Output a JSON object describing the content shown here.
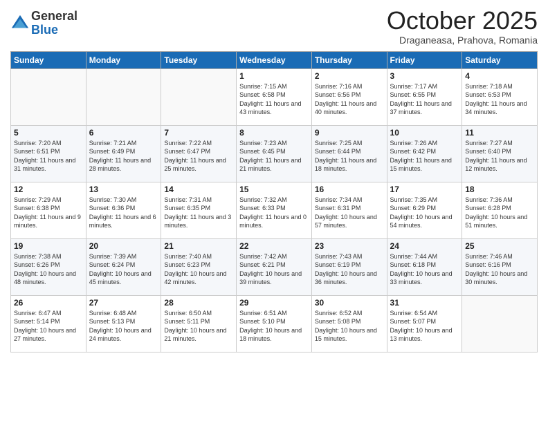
{
  "header": {
    "logo_general": "General",
    "logo_blue": "Blue",
    "month_title": "October 2025",
    "subtitle": "Draganeasa, Prahova, Romania"
  },
  "weekdays": [
    "Sunday",
    "Monday",
    "Tuesday",
    "Wednesday",
    "Thursday",
    "Friday",
    "Saturday"
  ],
  "weeks": [
    [
      {
        "day": "",
        "info": ""
      },
      {
        "day": "",
        "info": ""
      },
      {
        "day": "",
        "info": ""
      },
      {
        "day": "1",
        "info": "Sunrise: 7:15 AM\nSunset: 6:58 PM\nDaylight: 11 hours and 43 minutes."
      },
      {
        "day": "2",
        "info": "Sunrise: 7:16 AM\nSunset: 6:56 PM\nDaylight: 11 hours and 40 minutes."
      },
      {
        "day": "3",
        "info": "Sunrise: 7:17 AM\nSunset: 6:55 PM\nDaylight: 11 hours and 37 minutes."
      },
      {
        "day": "4",
        "info": "Sunrise: 7:18 AM\nSunset: 6:53 PM\nDaylight: 11 hours and 34 minutes."
      }
    ],
    [
      {
        "day": "5",
        "info": "Sunrise: 7:20 AM\nSunset: 6:51 PM\nDaylight: 11 hours and 31 minutes."
      },
      {
        "day": "6",
        "info": "Sunrise: 7:21 AM\nSunset: 6:49 PM\nDaylight: 11 hours and 28 minutes."
      },
      {
        "day": "7",
        "info": "Sunrise: 7:22 AM\nSunset: 6:47 PM\nDaylight: 11 hours and 25 minutes."
      },
      {
        "day": "8",
        "info": "Sunrise: 7:23 AM\nSunset: 6:45 PM\nDaylight: 11 hours and 21 minutes."
      },
      {
        "day": "9",
        "info": "Sunrise: 7:25 AM\nSunset: 6:44 PM\nDaylight: 11 hours and 18 minutes."
      },
      {
        "day": "10",
        "info": "Sunrise: 7:26 AM\nSunset: 6:42 PM\nDaylight: 11 hours and 15 minutes."
      },
      {
        "day": "11",
        "info": "Sunrise: 7:27 AM\nSunset: 6:40 PM\nDaylight: 11 hours and 12 minutes."
      }
    ],
    [
      {
        "day": "12",
        "info": "Sunrise: 7:29 AM\nSunset: 6:38 PM\nDaylight: 11 hours and 9 minutes."
      },
      {
        "day": "13",
        "info": "Sunrise: 7:30 AM\nSunset: 6:36 PM\nDaylight: 11 hours and 6 minutes."
      },
      {
        "day": "14",
        "info": "Sunrise: 7:31 AM\nSunset: 6:35 PM\nDaylight: 11 hours and 3 minutes."
      },
      {
        "day": "15",
        "info": "Sunrise: 7:32 AM\nSunset: 6:33 PM\nDaylight: 11 hours and 0 minutes."
      },
      {
        "day": "16",
        "info": "Sunrise: 7:34 AM\nSunset: 6:31 PM\nDaylight: 10 hours and 57 minutes."
      },
      {
        "day": "17",
        "info": "Sunrise: 7:35 AM\nSunset: 6:29 PM\nDaylight: 10 hours and 54 minutes."
      },
      {
        "day": "18",
        "info": "Sunrise: 7:36 AM\nSunset: 6:28 PM\nDaylight: 10 hours and 51 minutes."
      }
    ],
    [
      {
        "day": "19",
        "info": "Sunrise: 7:38 AM\nSunset: 6:26 PM\nDaylight: 10 hours and 48 minutes."
      },
      {
        "day": "20",
        "info": "Sunrise: 7:39 AM\nSunset: 6:24 PM\nDaylight: 10 hours and 45 minutes."
      },
      {
        "day": "21",
        "info": "Sunrise: 7:40 AM\nSunset: 6:23 PM\nDaylight: 10 hours and 42 minutes."
      },
      {
        "day": "22",
        "info": "Sunrise: 7:42 AM\nSunset: 6:21 PM\nDaylight: 10 hours and 39 minutes."
      },
      {
        "day": "23",
        "info": "Sunrise: 7:43 AM\nSunset: 6:19 PM\nDaylight: 10 hours and 36 minutes."
      },
      {
        "day": "24",
        "info": "Sunrise: 7:44 AM\nSunset: 6:18 PM\nDaylight: 10 hours and 33 minutes."
      },
      {
        "day": "25",
        "info": "Sunrise: 7:46 AM\nSunset: 6:16 PM\nDaylight: 10 hours and 30 minutes."
      }
    ],
    [
      {
        "day": "26",
        "info": "Sunrise: 6:47 AM\nSunset: 5:14 PM\nDaylight: 10 hours and 27 minutes."
      },
      {
        "day": "27",
        "info": "Sunrise: 6:48 AM\nSunset: 5:13 PM\nDaylight: 10 hours and 24 minutes."
      },
      {
        "day": "28",
        "info": "Sunrise: 6:50 AM\nSunset: 5:11 PM\nDaylight: 10 hours and 21 minutes."
      },
      {
        "day": "29",
        "info": "Sunrise: 6:51 AM\nSunset: 5:10 PM\nDaylight: 10 hours and 18 minutes."
      },
      {
        "day": "30",
        "info": "Sunrise: 6:52 AM\nSunset: 5:08 PM\nDaylight: 10 hours and 15 minutes."
      },
      {
        "day": "31",
        "info": "Sunrise: 6:54 AM\nSunset: 5:07 PM\nDaylight: 10 hours and 13 minutes."
      },
      {
        "day": "",
        "info": ""
      }
    ]
  ]
}
